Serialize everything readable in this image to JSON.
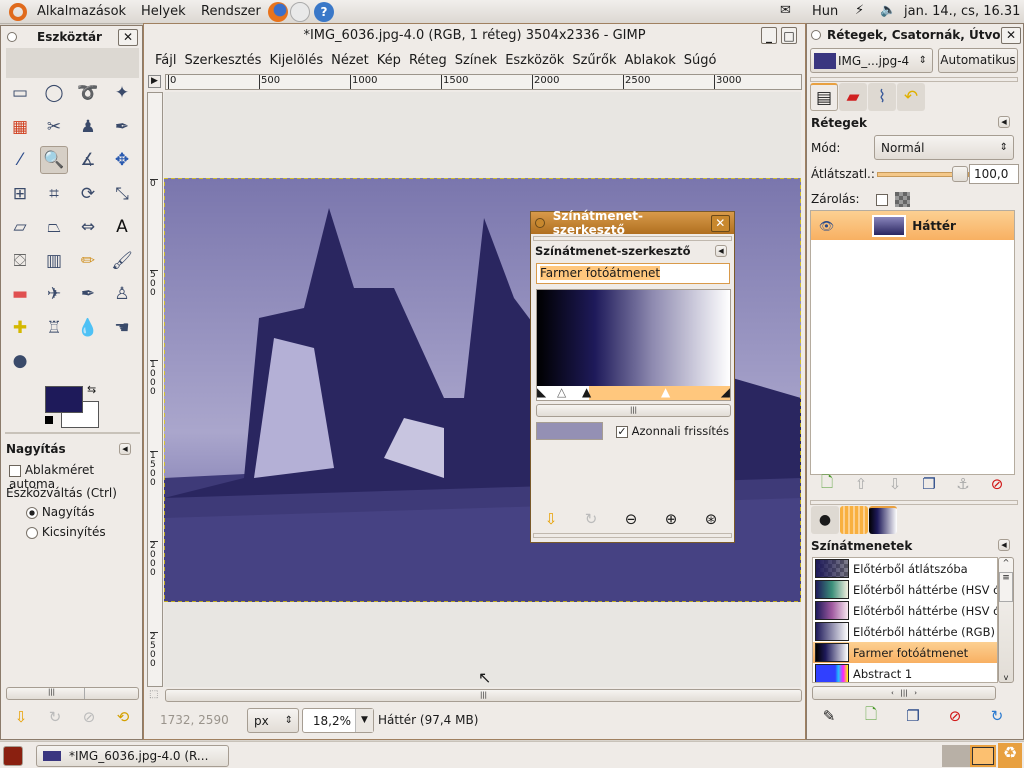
{
  "top_panel": {
    "menus": [
      "Alkalmazások",
      "Helyek",
      "Rendszer"
    ],
    "keyboard": "Hun",
    "clock": "jan. 14., cs, 16.31"
  },
  "toolbox": {
    "title": "Eszköztár",
    "tools": [
      "rect-select",
      "ellipse-select",
      "free-select",
      "fuzzy-select",
      "select-by-color",
      "scissors",
      "foreground-select",
      "paths",
      "color-picker",
      "zoom",
      "measure",
      "move",
      "align",
      "crop",
      "rotate",
      "scale",
      "shear",
      "perspective",
      "flip",
      "text",
      "bucket-fill",
      "blend",
      "pencil",
      "paintbrush",
      "eraser",
      "airbrush",
      "ink",
      "clone",
      "heal",
      "perspective-clone",
      "blur",
      "smudge",
      "dodge-burn"
    ],
    "fg_color": "#1e1a5a",
    "bg_color": "#ffffff",
    "options": {
      "title": "Nagyítás",
      "auto_resize": "Ablakméret automa",
      "toggle_label": "Eszközváltás  (Ctrl)",
      "radio_zoom_in": "Nagyítás",
      "radio_zoom_out": "Kicsinyítés",
      "selected": "Nagyítás"
    }
  },
  "image_window": {
    "title": "*IMG_6036.jpg-4.0 (RGB, 1 réteg) 3504x2336 - GIMP",
    "menu": [
      "Fájl",
      "Szerkesztés",
      "Kijelölés",
      "Nézet",
      "Kép",
      "Réteg",
      "Színek",
      "Eszközök",
      "Szűrők",
      "Ablakok",
      "Súgó"
    ],
    "hruler": [
      "0",
      "500",
      "1000",
      "1500",
      "2000",
      "2500",
      "3000"
    ],
    "vruler": [
      "0",
      "500",
      "1000",
      "1500",
      "2000",
      "2500"
    ],
    "status": {
      "coords": "1732, 2590",
      "unit": "px",
      "zoom": "18,2%",
      "layer_info": "Háttér (97,4 MB)"
    }
  },
  "gradient_editor": {
    "window_title": "Színátmenet-szerkesztő",
    "panel_title": "Színátmenet-szerkesztő",
    "name_value": "Farmer fotóátmenet",
    "instant_update": "Azonnali frissítés",
    "instant_checked": true,
    "preview_color": "#9490b4",
    "stops": [
      "#000000",
      "#1e1a5a",
      "#ffffff"
    ]
  },
  "layers_dock": {
    "title": "Rétegek, Csatornák, Útvo",
    "image_select": "IMG_...jpg-4",
    "auto_button": "Automatikus",
    "panel_title": "Rétegek",
    "mode_label": "Mód:",
    "mode_value": "Normál",
    "opacity_label": "Átlátszatl.:",
    "opacity_value": "100,0",
    "opacity": 100,
    "lock_label": "Zárolás:",
    "layers": [
      {
        "name": "Háttér",
        "visible": true
      }
    ]
  },
  "gradients_dock": {
    "panel_title": "Színátmenetek",
    "items": [
      {
        "name": "Előtérből átlátszóba",
        "swatch": "linear-gradient(90deg,#1e1a5a,rgba(30,26,90,0.2)),repeating-conic-gradient(#999 0 25%,#666 0 50%) 0 0/8px 8px"
      },
      {
        "name": "Előtérből háttérbe (HSV ó",
        "swatch": "linear-gradient(90deg,#1e1a5a,#3b8f7a,#f4f0e0)"
      },
      {
        "name": "Előtérből háttérbe (HSV ó",
        "swatch": "linear-gradient(90deg,#1e1a5a,#a05aa0,#f8e8f0)"
      },
      {
        "name": "Előtérből háttérbe (RGB)",
        "swatch": "linear-gradient(90deg,#1e1a5a,#fff)"
      },
      {
        "name": "Farmer fotóátmenet",
        "swatch": "linear-gradient(90deg,#000,#1e1a5a 30%,#fff)",
        "selected": true
      },
      {
        "name": "Abstract 1",
        "swatch": "linear-gradient(90deg,#3040ff 60%,#20c0ff 70%,#ff20ff 85%,#ffff00)"
      }
    ]
  },
  "taskbar": {
    "task": "*IMG_6036.jpg-4.0 (R..."
  }
}
